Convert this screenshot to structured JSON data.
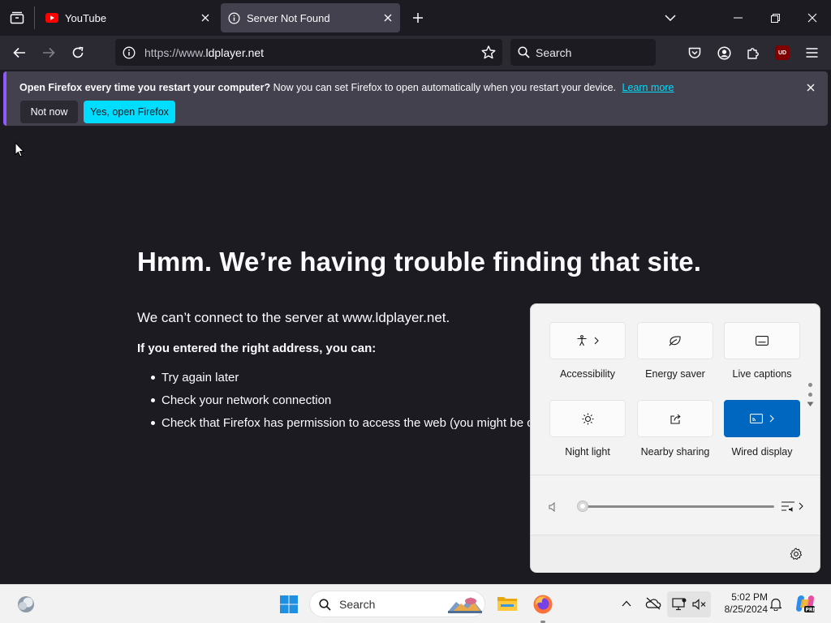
{
  "browser": {
    "tabs": [
      {
        "label": "YouTube",
        "active": false
      },
      {
        "label": "Server Not Found",
        "active": true
      }
    ],
    "url_prefix": "https://www.",
    "url_domain": "ldplayer.net",
    "search_placeholder": "Search",
    "addon_badge": "UD"
  },
  "notification": {
    "bold_text": "Open Firefox every time you restart your computer?",
    "text": "Now you can set Firefox to open automatically when you restart your device.",
    "link": "Learn more",
    "not_now": "Not now",
    "yes": "Yes, open Firefox",
    "accent_color": "#00ddff"
  },
  "page": {
    "title": "Hmm. We’re having trouble finding that site.",
    "subtitle": "We can’t connect to the server at www.ldplayer.net.",
    "lead": "If you entered the right address, you can:",
    "items": [
      "Try again later",
      "Check your network connection",
      "Check that Firefox has permission to access the web (you might be connected but behind a firewall)"
    ]
  },
  "quick_settings": {
    "tiles": [
      {
        "label": "Accessibility",
        "icon": "accessibility-icon",
        "active": false
      },
      {
        "label": "Energy saver",
        "icon": "leaf-icon",
        "active": false
      },
      {
        "label": "Live captions",
        "icon": "captions-icon",
        "active": false
      },
      {
        "label": "Night light",
        "icon": "brightness-icon",
        "active": false
      },
      {
        "label": "Nearby sharing",
        "icon": "share-icon",
        "active": false
      },
      {
        "label": "Wired display",
        "icon": "cast-icon",
        "active": true
      }
    ],
    "volume_level": 0,
    "active_color": "#0067c0"
  },
  "taskbar": {
    "search_placeholder": "Search",
    "time": "5:02 PM",
    "date": "8/25/2024"
  }
}
